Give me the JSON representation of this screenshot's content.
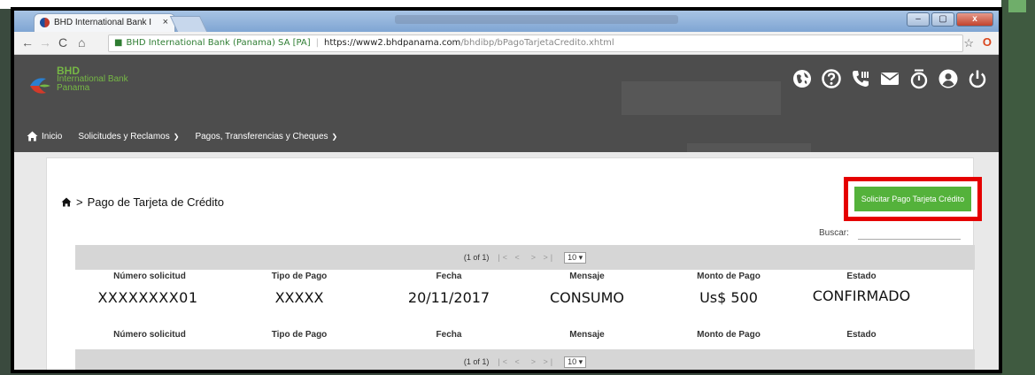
{
  "colors": {
    "header_bg": "#4d4d4d",
    "brand_green": "#76b845",
    "button_green": "#54b23b",
    "highlight_red": "#e50000",
    "pager_bg": "#d6d6d6"
  },
  "browser": {
    "tab_title": "BHD International Bank I",
    "tab_close": "×",
    "site_identity": "BHD International Bank (Panama) SA [PA]",
    "url_host": "https://www2.bhdpanama.com",
    "url_path": "/bhdibp/bPagoTarjetaCredito.xhtml",
    "window_min": "–",
    "window_max": "▢",
    "window_close": "x"
  },
  "header": {
    "logo_brand": "BHD",
    "logo_sub": "International Bank",
    "logo_sub2": "Panama",
    "icons": [
      "globe-icon",
      "help-icon",
      "phone-icon",
      "mail-icon",
      "timer-icon",
      "user-icon",
      "power-icon"
    ]
  },
  "nav": {
    "home": "Inicio",
    "requests": "Solicitudes y Reclamos",
    "payments": "Pagos, Transferencias y Cheques"
  },
  "page": {
    "breadcrumb_sep": ">",
    "title": "Pago de Tarjeta de Crédito",
    "request_button": "Solicitar Pago Tarjeta Crédito",
    "search_label": "Buscar:",
    "search_value": ""
  },
  "pager": {
    "info": "(1 of 1)",
    "nav_prev": "|< <",
    "nav_next": "> >|",
    "rows_per_page": "10 ▾"
  },
  "table": {
    "columns": [
      "Número solicitud",
      "Tipo de Pago",
      "Fecha",
      "Mensaje",
      "Monto de Pago",
      "Estado"
    ],
    "rows": [
      {
        "numero": "XXXXXXXX01",
        "tipo": "XXXXX",
        "fecha": "20/11/2017",
        "mensaje": "CONSUMO",
        "monto": "Us$ 500",
        "estado": "CONFIRMADO"
      }
    ]
  }
}
